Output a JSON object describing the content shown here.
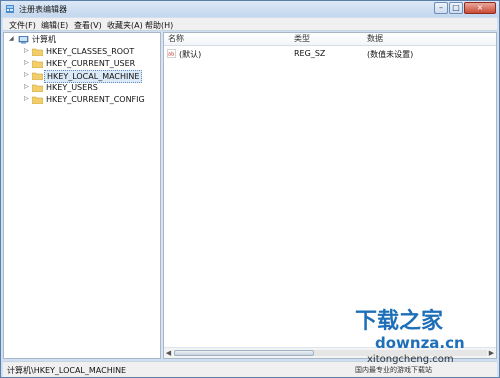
{
  "window": {
    "title": "注册表编辑器",
    "controls": [
      "minimize",
      "maximize",
      "close"
    ]
  },
  "menu": [
    "文件(F)",
    "编辑(E)",
    "查看(V)",
    "收藏夹(A)",
    "帮助(H)"
  ],
  "tree": {
    "root": "计算机",
    "items": [
      {
        "label": "HKEY_CLASSES_ROOT"
      },
      {
        "label": "HKEY_CURRENT_USER"
      },
      {
        "label": "HKEY_LOCAL_MACHINE",
        "selected": true
      },
      {
        "label": "HKEY_USERS"
      },
      {
        "label": "HKEY_CURRENT_CONFIG"
      }
    ]
  },
  "list": {
    "headers": {
      "name": "名称",
      "type": "类型",
      "data": "数据"
    },
    "rows": [
      {
        "icon": "ab",
        "name": "(默认)",
        "type": "REG_SZ",
        "data": "(数值未设置)"
      }
    ]
  },
  "status": {
    "path": "计算机\\HKEY_LOCAL_MACHINE"
  },
  "watermark": {
    "brand": "下载之家",
    "site": "downza.cn",
    "overlay_site": "xitongcheng.com",
    "overlay_text": "国内最专业的游戏下载站",
    "brand_color": "#1e6fb8"
  },
  "colors": {
    "accent": "#5b7fa8",
    "selection": "#dceaf8"
  }
}
